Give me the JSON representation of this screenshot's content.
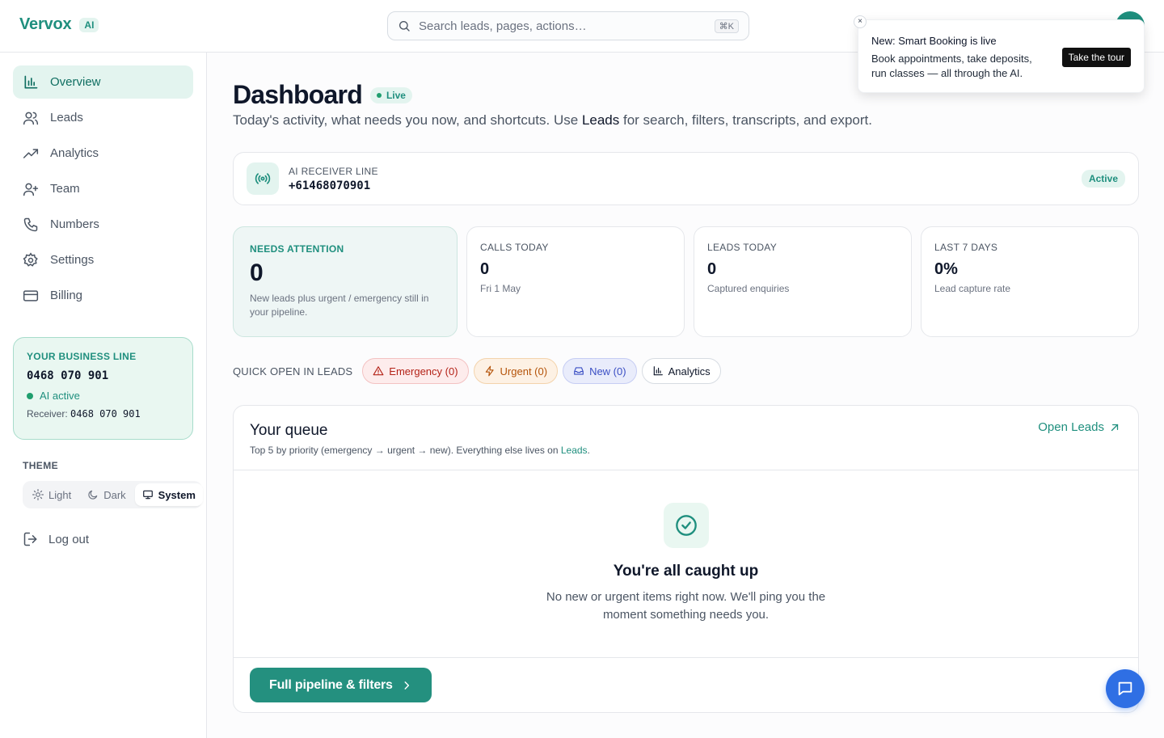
{
  "brand": {
    "name": "Vervox",
    "badge": "AI"
  },
  "search": {
    "placeholder": "Search leads, pages, actions…",
    "shortcut": "⌘K"
  },
  "sidebar": {
    "items": [
      {
        "label": "Overview",
        "icon": "bar-chart-icon",
        "active": true
      },
      {
        "label": "Leads",
        "icon": "users-icon",
        "active": false
      },
      {
        "label": "Analytics",
        "icon": "trending-up-icon",
        "active": false
      },
      {
        "label": "Team",
        "icon": "user-plus-icon",
        "active": false
      },
      {
        "label": "Numbers",
        "icon": "phone-icon",
        "active": false
      },
      {
        "label": "Settings",
        "icon": "gear-icon",
        "active": false
      },
      {
        "label": "Billing",
        "icon": "credit-card-icon",
        "active": false
      }
    ],
    "business_line": {
      "title": "YOUR BUSINESS LINE",
      "number": "0468 070 901",
      "status": "AI active",
      "receiver_label": "Receiver:",
      "receiver_number": "0468 070 901"
    },
    "theme": {
      "label": "THEME",
      "options": [
        "Light",
        "Dark",
        "System"
      ],
      "selected": "System"
    },
    "logout_label": "Log out"
  },
  "main": {
    "title": "Dashboard",
    "live_badge": "Live",
    "subtitle_before": "Today's activity, what needs you now, and shortcuts. Use ",
    "subtitle_link": "Leads",
    "subtitle_after": " for search, filters, transcripts, and export.",
    "receiver_line": {
      "label": "AI RECEIVER LINE",
      "number": "+61468070901",
      "status": "Active"
    },
    "stats": [
      {
        "label": "NEEDS ATTENTION",
        "value": "0",
        "sub": "New leads plus urgent / emergency still in your pipeline."
      },
      {
        "label": "CALLS TODAY",
        "value": "0",
        "sub": "Fri 1 May"
      },
      {
        "label": "LEADS TODAY",
        "value": "0",
        "sub": "Captured enquiries"
      },
      {
        "label": "LAST 7 DAYS",
        "value": "0%",
        "sub": "Lead capture rate"
      }
    ],
    "quick_open": {
      "label": "QUICK OPEN IN LEADS",
      "chips": [
        "Emergency (0)",
        "Urgent (0)",
        "New (0)",
        "Analytics"
      ]
    },
    "queue": {
      "title": "Your queue",
      "sub_before": "Top 5 by priority (emergency → urgent → new). Everything else lives on ",
      "sub_link": "Leads",
      "sub_after": ".",
      "open_leads": "Open Leads",
      "empty_title": "You're all caught up",
      "empty_sub": "No new or urgent items right now. We'll ping you the moment something needs you.",
      "pipeline_button": "Full pipeline & filters"
    }
  },
  "popup": {
    "close": "×",
    "title": "New: Smart Booking is live",
    "body": "Book appointments, take deposits, run classes — all through the AI.",
    "button": "Take the tour"
  },
  "colors": {
    "accent": "#1f8f7e",
    "chat": "#2f6fe4",
    "emergency": "#b42318",
    "urgent": "#b45309",
    "new": "#3b4fc4"
  }
}
